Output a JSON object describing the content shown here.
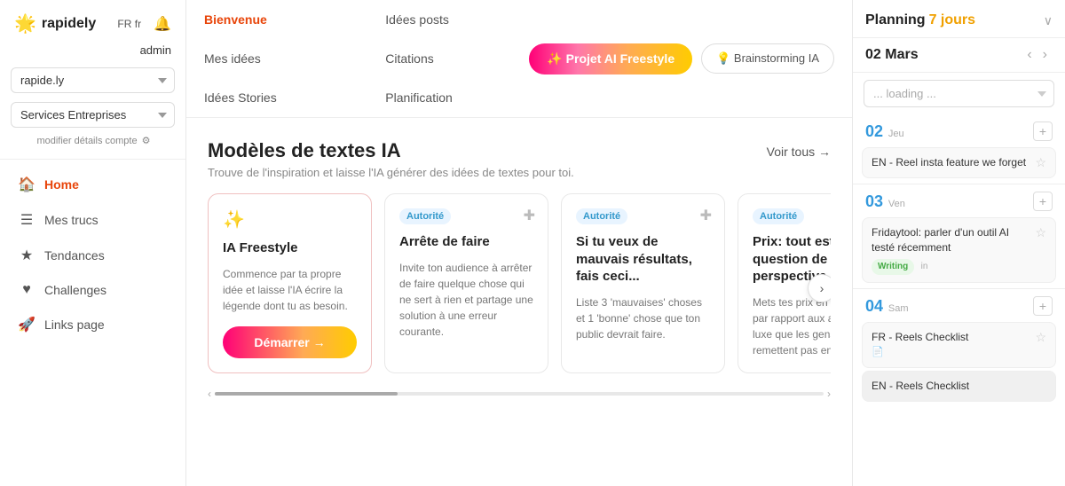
{
  "sidebar": {
    "logo_text": "rapidely",
    "lang": "FR fr",
    "admin_label": "admin",
    "workspace_value": "rapide.ly",
    "services_value": "Services Entreprises",
    "modify_label": "modifier détails compte",
    "nav_items": [
      {
        "id": "home",
        "label": "Home",
        "icon": "🏠",
        "active": true
      },
      {
        "id": "mes-trucs",
        "label": "Mes trucs",
        "icon": "☰",
        "active": false
      },
      {
        "id": "tendances",
        "label": "Tendances",
        "icon": "★",
        "active": false
      },
      {
        "id": "challenges",
        "label": "Challenges",
        "icon": "♥",
        "active": false
      },
      {
        "id": "links",
        "label": "Links page",
        "icon": "🚀",
        "active": false
      }
    ]
  },
  "top_nav": {
    "tabs": [
      {
        "id": "bienvenue",
        "label": "Bienvenue",
        "active": true
      },
      {
        "id": "idees-posts",
        "label": "Idées posts",
        "active": false
      },
      {
        "id": "mes-idees",
        "label": "Mes idées",
        "active": false
      },
      {
        "id": "citations",
        "label": "Citations",
        "active": false
      },
      {
        "id": "idees-stories",
        "label": "Idées Stories",
        "active": false
      },
      {
        "id": "planification",
        "label": "Planification",
        "active": false
      }
    ],
    "btn_freestyle_label": "✨ Projet AI Freestyle",
    "btn_brainstorm_label": "💡 Brainstorming IA"
  },
  "main_content": {
    "section_title": "Modèles de textes IA",
    "section_subtitle": "Trouve de l'inspiration et laisse l'IA générer des idées de textes pour toi.",
    "voir_tous_label": "Voir tous →",
    "cards": [
      {
        "id": "ia-freestyle",
        "type": "freestyle",
        "icon": "✨",
        "title": "IA Freestyle",
        "desc": "Commence par ta propre idée et laisse l'IA écrire la légende dont tu as besoin.",
        "btn_label": "Démarrer",
        "badge": null
      },
      {
        "id": "arrete-de-faire",
        "type": "autorite",
        "badge": "Autorité",
        "title": "Arrête de faire",
        "desc": "Invite ton audience à arrêter de faire quelque chose qui ne sert à rien et partage une solution à une erreur courante.",
        "btn_label": null
      },
      {
        "id": "mauvais-resultats",
        "type": "autorite",
        "badge": "Autorité",
        "title": "Si tu veux de mauvais résultats, fais ceci...",
        "desc": "Liste 3 'mauvaises' choses et 1 'bonne' chose que ton public devrait faire.",
        "btn_label": null
      },
      {
        "id": "prix-perspective",
        "type": "autorite",
        "badge": "Autorité",
        "title": "Prix: tout est une question de perspective",
        "desc": "Mets tes prix en perspective par rapport aux articles de luxe que les gens ne remettent pas en...",
        "btn_label": null
      }
    ],
    "demarrer_label": "Démarrer →"
  },
  "right_panel": {
    "title": "Planning",
    "days_label": "7 jours",
    "date_label": "02 Mars",
    "loading_placeholder": "... loading ...",
    "days": [
      {
        "number": "02",
        "name": "Jeu",
        "items": [
          {
            "text": "EN - Reel insta feature we forget",
            "star": true,
            "badge": null
          }
        ]
      },
      {
        "number": "03",
        "name": "Ven",
        "items": [
          {
            "text": "Fridaytool: parler d'un outil AI testé récemment",
            "star": true,
            "badge": "Writing",
            "badge_in": "in"
          }
        ]
      },
      {
        "number": "04",
        "name": "Sam",
        "items": [
          {
            "text": "FR - Reels Checklist",
            "star": true,
            "badge": null
          },
          {
            "text": "EN - Reels Checklist",
            "star": false,
            "badge": null,
            "partial": true
          }
        ]
      }
    ]
  }
}
